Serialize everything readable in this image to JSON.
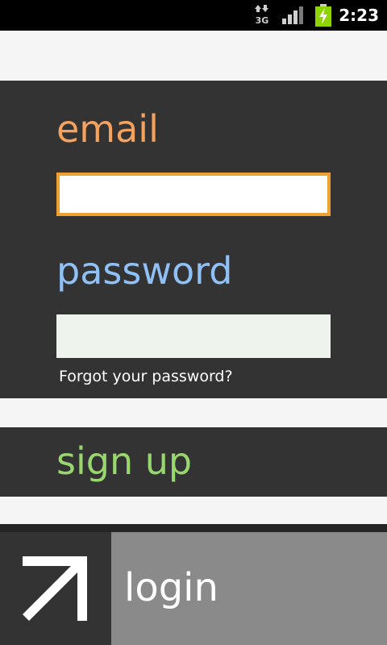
{
  "status_bar": {
    "time": "2:23",
    "network_icon": "3g-data-icon",
    "signal_icon": "signal-strength-icon",
    "battery_icon": "battery-charging-icon",
    "network_label": "3G"
  },
  "form": {
    "email_label": "email",
    "email_value": "",
    "password_label": "password",
    "password_value": "",
    "forgot_link": "Forgot your password?"
  },
  "signup": {
    "label": "sign up"
  },
  "bottom_bar": {
    "login_label": "login",
    "arrow_icon": "arrow-up-right-icon"
  },
  "colors": {
    "email_accent": "#f4a25e",
    "password_accent": "#8fc0f6",
    "signup_accent": "#98d66e",
    "panel_bg": "#333333",
    "focus_border": "#f0a030",
    "login_bg": "#8a8a8a"
  }
}
